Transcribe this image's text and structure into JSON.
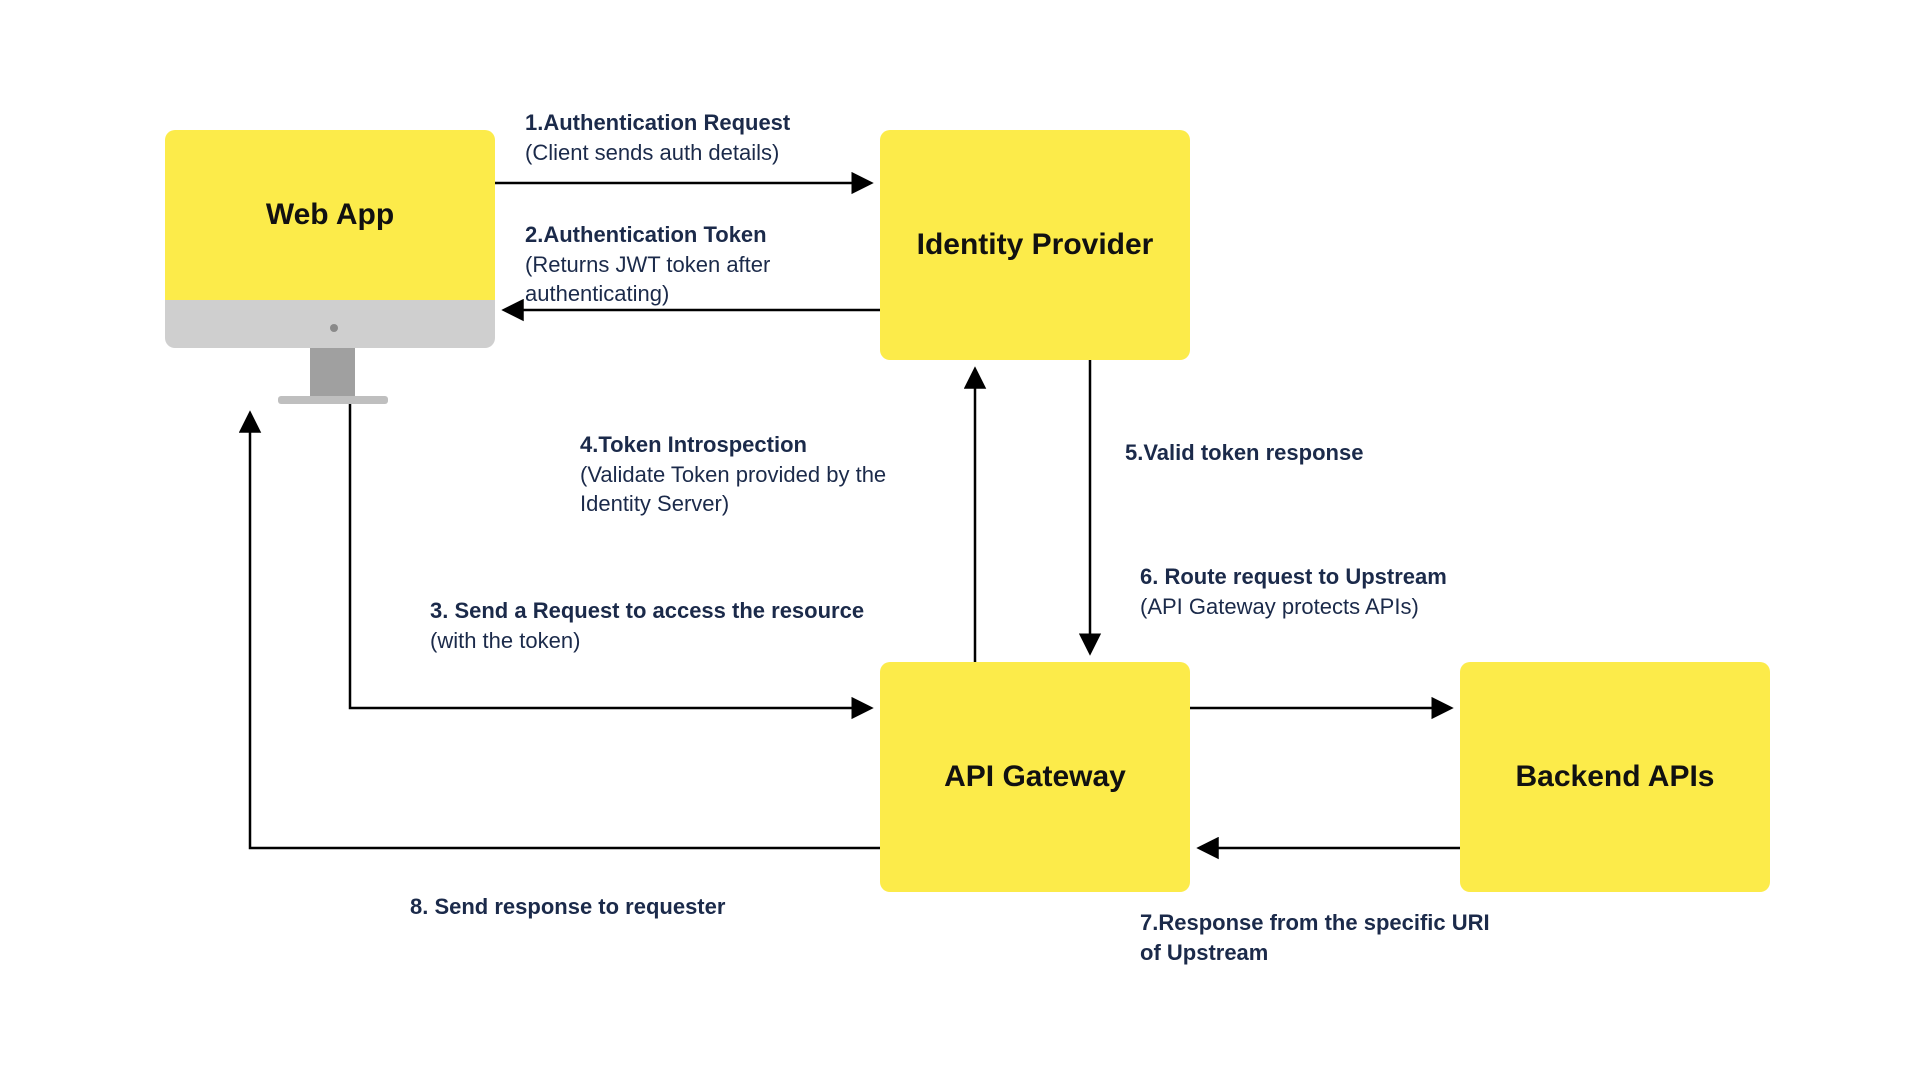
{
  "nodes": {
    "webapp": "Web App",
    "idp": "Identity Provider",
    "gateway": "API Gateway",
    "backend": "Backend APIs"
  },
  "steps": {
    "s1": {
      "title": "1.Authentication Request",
      "detail": "(Client sends auth details)"
    },
    "s2": {
      "title": "2.Authentication Token",
      "detail": "(Returns JWT token after authenticating)"
    },
    "s3": {
      "title": "3. Send a Request to access the resource",
      "detail": "(with the token)"
    },
    "s4": {
      "title": "4.Token Introspection",
      "detail": "(Validate Token provided by the Identity Server)"
    },
    "s5": {
      "title": "5.Valid token response",
      "detail": ""
    },
    "s6": {
      "title": "6. Route request to Upstream",
      "detail": "(API Gateway protects APIs)"
    },
    "s7": {
      "title": "7.Response from the specific URI of Upstream",
      "detail": ""
    },
    "s8": {
      "title": "8. Send response to requester",
      "detail": ""
    }
  },
  "flow": [
    {
      "step": 1,
      "from": "webapp",
      "to": "idp",
      "label_key": "s1"
    },
    {
      "step": 2,
      "from": "idp",
      "to": "webapp",
      "label_key": "s2"
    },
    {
      "step": 3,
      "from": "webapp",
      "to": "gateway",
      "label_key": "s3"
    },
    {
      "step": 4,
      "from": "gateway",
      "to": "idp",
      "label_key": "s4"
    },
    {
      "step": 5,
      "from": "idp",
      "to": "gateway",
      "label_key": "s5"
    },
    {
      "step": 6,
      "from": "gateway",
      "to": "backend",
      "label_key": "s6"
    },
    {
      "step": 7,
      "from": "backend",
      "to": "gateway",
      "label_key": "s7"
    },
    {
      "step": 8,
      "from": "gateway",
      "to": "webapp",
      "label_key": "s8"
    }
  ]
}
